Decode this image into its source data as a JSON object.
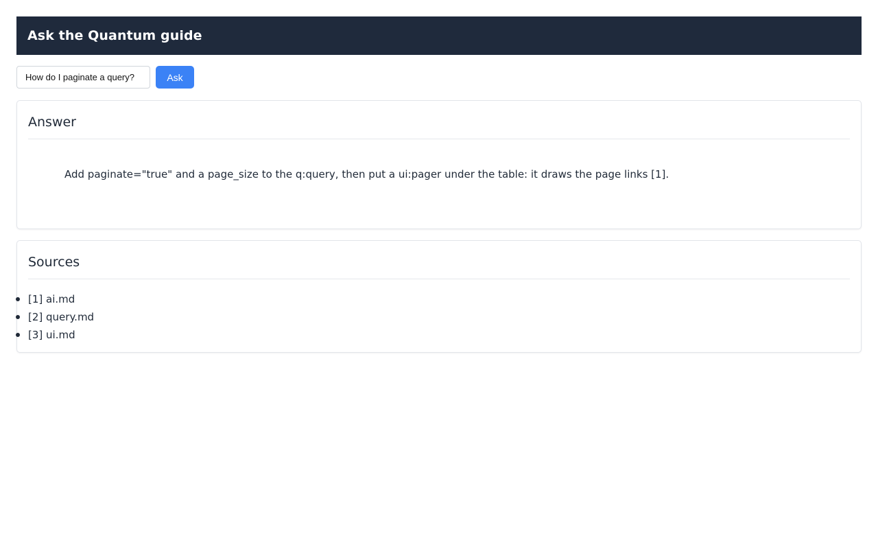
{
  "header": {
    "title": "Ask the Quantum guide"
  },
  "ask": {
    "input_value": "How do I paginate a query?",
    "button_label": "Ask"
  },
  "answer": {
    "heading": "Answer",
    "text": "Add paginate=\"true\" and a page_size to the q:query, then put a ui:pager under the table: it draws the page links [1]."
  },
  "sources": {
    "heading": "Sources",
    "items": [
      {
        "label": "[1] ai.md"
      },
      {
        "label": "[2] query.md"
      },
      {
        "label": "[3] ui.md"
      }
    ]
  },
  "colors": {
    "header_bg": "#1f2a3c",
    "accent": "#3b82f6"
  }
}
